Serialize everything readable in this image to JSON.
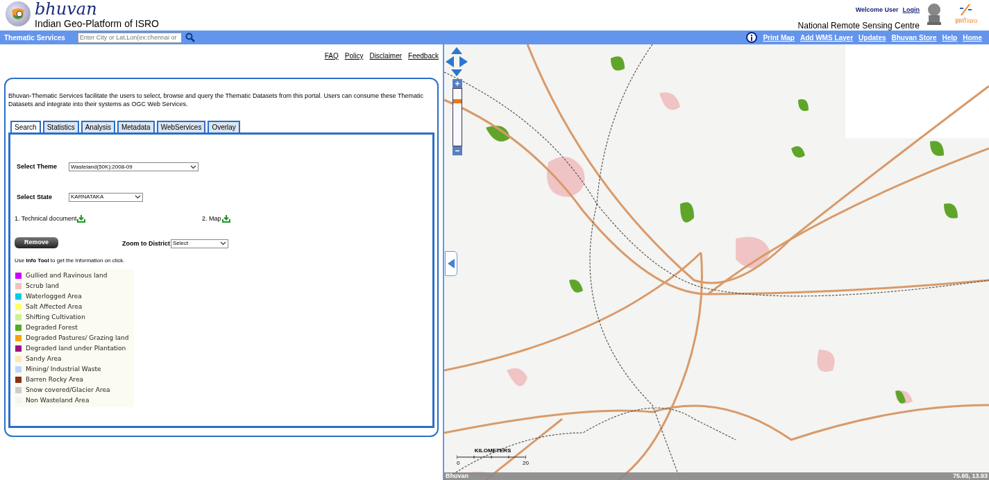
{
  "header": {
    "logo_text": "bhuvan",
    "tagline": "Indian Geo-Platform of ISRO",
    "welcome": "Welcome User",
    "login": "Login",
    "organisation": "National Remote Sensing Centre",
    "isro_logo_text": [
      "इसरो",
      "isro"
    ]
  },
  "navbar": {
    "title": "Thematic Services",
    "search": {
      "placeholder": "Enter City or Lat,Lon(ex:chennai or"
    },
    "links": [
      "Print Map",
      "Add WMS Layer",
      "Updates",
      "Bhuvan Store",
      "Help",
      "Home"
    ]
  },
  "top_links": [
    "FAQ",
    "Policy",
    "Disclaimer",
    "Feedback"
  ],
  "panel": {
    "description": "Bhuvan-Thematic Services facilitate the users to select, browse and query the Thematic Datasets from this portal. Users can consume these Thematic Datasets and integrate into their systems as OGC Web Services.",
    "tabs": [
      {
        "label": "Search",
        "selected": true
      },
      {
        "label": "Statistics",
        "selected": false
      },
      {
        "label": "Analysis",
        "selected": false
      },
      {
        "label": "Metadata",
        "selected": false
      },
      {
        "label": "WebServices",
        "selected": false
      },
      {
        "label": "Overlay",
        "selected": false
      }
    ],
    "theme": {
      "label": "Select Theme",
      "value": "Wasteland(50K):2008-09"
    },
    "state": {
      "label": "Select State",
      "value": "KARNATAKA"
    },
    "downloads": [
      "1. Technical document",
      "2. Map"
    ],
    "remove_button": "Remove",
    "district": {
      "label": "Zoom to District",
      "value": "Select"
    },
    "info_note": "Use **Info Tool** to get the Information on click.",
    "legend": [
      {
        "label": "Gullied and Ravinous land",
        "color": "#cc00ff"
      },
      {
        "label": "Scrub land",
        "color": "#f2c0c0"
      },
      {
        "label": "Waterlogged Area",
        "color": "#00ccee"
      },
      {
        "label": "Salt Affected Area",
        "color": "#ffff66"
      },
      {
        "label": "Shifting Cultivation",
        "color": "#ccf099"
      },
      {
        "label": "Degraded Forest",
        "color": "#55aa22"
      },
      {
        "label": "Degraded Pastures/ Grazing land",
        "color": "#f5a500"
      },
      {
        "label": "Degraded land under Plantation",
        "color": "#a0107f"
      },
      {
        "label": "Sandy Area",
        "color": "#fde9b5"
      },
      {
        "label": "Mining/ Industrial Waste",
        "color": "#c0d4ff"
      },
      {
        "label": "Barren Rocky Area",
        "color": "#8b3010"
      },
      {
        "label": "Snow covered/Glacier Area",
        "color": "#cccccc"
      },
      {
        "label": "Non Wasteland Area",
        "color": "#f4f4f4"
      }
    ]
  },
  "map": {
    "zoom": {
      "level": 0.8
    },
    "scale": {
      "label": "KILOMETERS",
      "ticks": [
        "0",
        "20"
      ]
    },
    "status_bar": {
      "source": "Bhuvan",
      "coordinates": "75.65, 13.93"
    }
  }
}
